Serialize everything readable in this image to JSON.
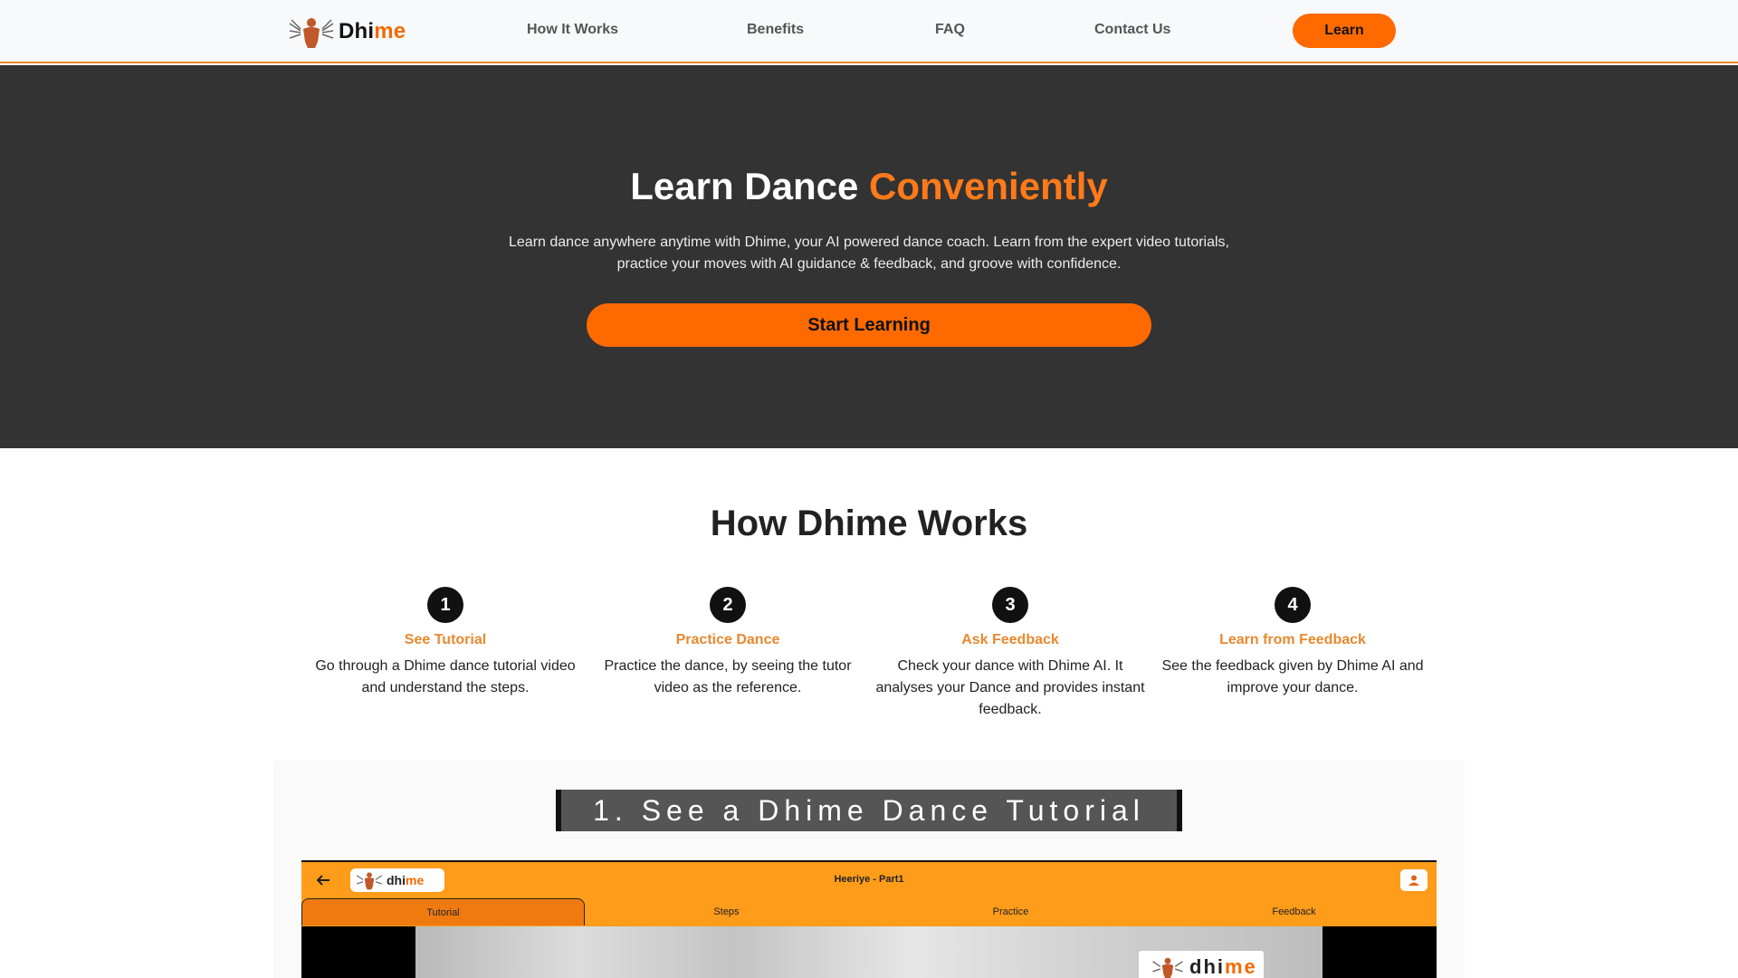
{
  "colors": {
    "accent": "#ff6a00",
    "hero_bg": "#333333",
    "step_title": "#e8892e",
    "app_bar": "#ff9c1a"
  },
  "nav": {
    "logo": {
      "prefix": "Dhi",
      "accent": "me"
    },
    "links": [
      "How It Works",
      "Benefits",
      "FAQ",
      "Contact Us"
    ],
    "cta": "Learn"
  },
  "hero": {
    "title": "Learn Dance",
    "title_accent": "Conveniently",
    "subtitle": "Learn dance anywhere anytime with Dhime, your AI powered dance coach. Learn from the expert video tutorials, practice your moves with AI guidance & feedback, and groove with confidence.",
    "button": "Start Learning"
  },
  "how": {
    "title": "How Dhime Works",
    "steps": [
      {
        "num": "1",
        "title": "See Tutorial",
        "desc": "Go through a Dhime dance tutorial video and understand the steps."
      },
      {
        "num": "2",
        "title": "Practice Dance",
        "desc": "Practice the dance, by seeing the tutor video as the reference."
      },
      {
        "num": "3",
        "title": "Ask Feedback",
        "desc": "Check your dance with Dhime AI. It analyses your Dance and provides instant feedback."
      },
      {
        "num": "4",
        "title": "Learn from Feedback",
        "desc": "See the feedback given by Dhime AI and improve your dance."
      }
    ]
  },
  "preview": {
    "banner": "1. See a Dhime Dance Tutorial",
    "app": {
      "logo": {
        "prefix": "dhi",
        "accent": "me"
      },
      "title": "Heeriye - Part1",
      "tabs": [
        "Tutorial",
        "Steps",
        "Practice",
        "Feedback"
      ],
      "active_tab": "Tutorial",
      "video_logo": {
        "prefix": "dhi",
        "accent": "me"
      }
    }
  },
  "icons": [
    "dancer-logo-icon",
    "back-arrow-icon",
    "user-icon"
  ]
}
